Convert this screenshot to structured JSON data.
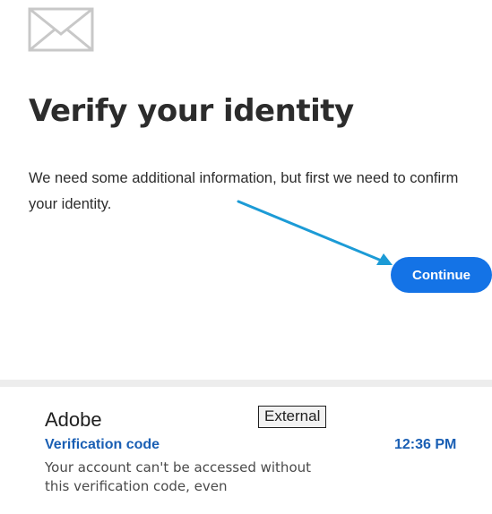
{
  "verify": {
    "title": "Verify your identity",
    "message": "We need some additional information, but first we need to confirm your identity.",
    "continue_label": "Continue",
    "icon": "envelope-icon",
    "accent_color": "#1473e6",
    "arrow_color": "#1c9bd6"
  },
  "email": {
    "sender": "Adobe",
    "tag": "External",
    "subject": "Verification code",
    "time": "12:36 PM",
    "preview": "Your account can't be accessed without this verification code, even",
    "link_color": "#1a5fb4"
  }
}
